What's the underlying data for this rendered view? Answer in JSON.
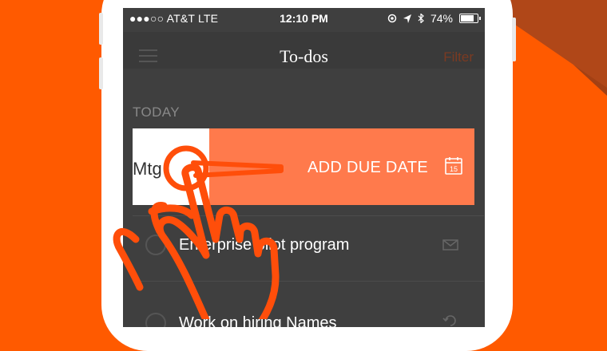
{
  "status_bar": {
    "carrier": "●●●○○ AT&T  LTE",
    "time": "12:10 PM",
    "battery_text": "74%",
    "battery_level": 0.74,
    "icons": [
      "location-lock-icon",
      "location-arrow-icon",
      "bluetooth-icon",
      "battery-icon"
    ]
  },
  "nav": {
    "title": "To-dos",
    "filter_label": "Filter",
    "menu_icon": "hamburger-icon"
  },
  "list": {
    "section_title": "TODAY",
    "swiped_item_partial_text": "Mtg",
    "swipe_action_label": "ADD DUE DATE",
    "calendar_day": "15",
    "items": [
      {
        "text": "Enterprise pilot program",
        "icon": "envelope-icon"
      },
      {
        "text": "Work on hiring Names",
        "icon": "recurring-icon"
      }
    ]
  },
  "colors": {
    "background_orange": "#ff5a00",
    "swipe_orange": "#ff7a4c",
    "screen_dark": "#3f3f3f",
    "hand_outline": "#ff4e0a"
  },
  "overlay": {
    "gesture": "swipe-left hand pointer"
  }
}
